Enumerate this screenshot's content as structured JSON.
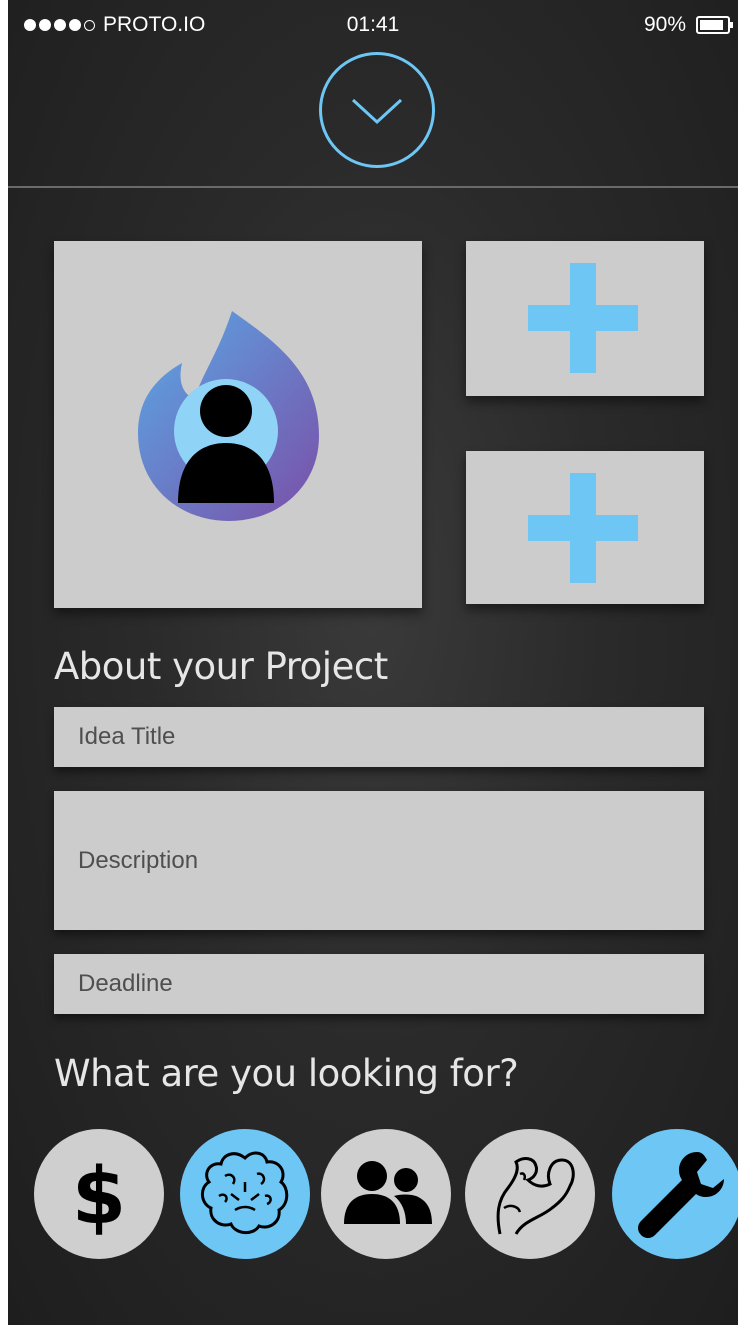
{
  "status_bar": {
    "carrier": "PROTO.IO",
    "time": "01:41",
    "battery": "90%"
  },
  "header": {
    "collapse_icon": "chevron-down-icon"
  },
  "media": {
    "main_icon": "user-flame-avatar-icon",
    "add_icon": "plus-icon"
  },
  "about": {
    "title": "About your Project",
    "idea_title_placeholder": "Idea Title",
    "description_placeholder": "Description",
    "deadline_placeholder": "Deadline"
  },
  "looking_for": {
    "title": "What are you looking for?",
    "options": [
      {
        "icon": "dollar-icon",
        "selected": false
      },
      {
        "icon": "brain-icon",
        "selected": true
      },
      {
        "icon": "people-icon",
        "selected": false
      },
      {
        "icon": "muscle-arm-icon",
        "selected": false
      },
      {
        "icon": "wrench-icon",
        "selected": true
      }
    ]
  },
  "colors": {
    "accent": "#6ec6f5",
    "tile": "#cccccc",
    "background": "#2a2a2a"
  }
}
